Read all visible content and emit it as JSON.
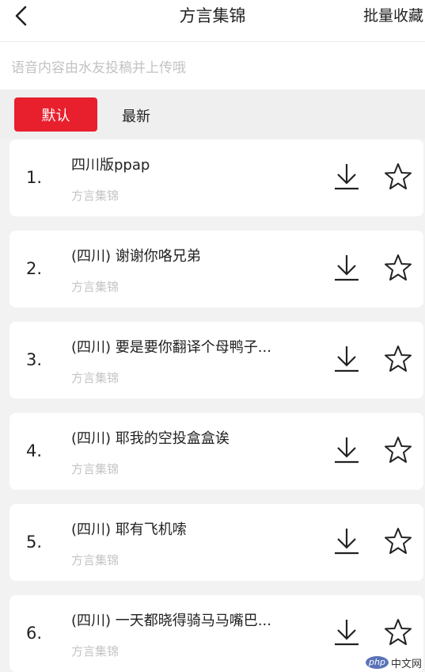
{
  "header": {
    "title": "方言集锦",
    "batch_label": "批量收藏"
  },
  "notice": "语音内容由水友投稿并上传哦",
  "tabs": [
    {
      "label": "默认",
      "active": true
    },
    {
      "label": "最新",
      "active": false
    }
  ],
  "items": [
    {
      "index": "1.",
      "title": "四川版ppap",
      "subtitle": "方言集锦"
    },
    {
      "index": "2.",
      "title": "(四川) 谢谢你咯兄弟",
      "subtitle": "方言集锦"
    },
    {
      "index": "3.",
      "title": "(四川) 要是要你翻译个母鸭子...",
      "subtitle": "方言集锦"
    },
    {
      "index": "4.",
      "title": "(四川) 耶我的空投盒盒诶",
      "subtitle": "方言集锦"
    },
    {
      "index": "5.",
      "title": "(四川) 耶有飞机嗦",
      "subtitle": "方言集锦"
    },
    {
      "index": "6.",
      "title": "(四川) 一天都晓得骑马马嘴巴...",
      "subtitle": "方言集锦"
    }
  ],
  "icons": {
    "back": "chevron-left-icon",
    "download": "download-icon",
    "favorite": "star-outline-icon"
  },
  "colors": {
    "accent": "#e8202d"
  },
  "watermark": {
    "logo": "php",
    "text": "中文网"
  }
}
